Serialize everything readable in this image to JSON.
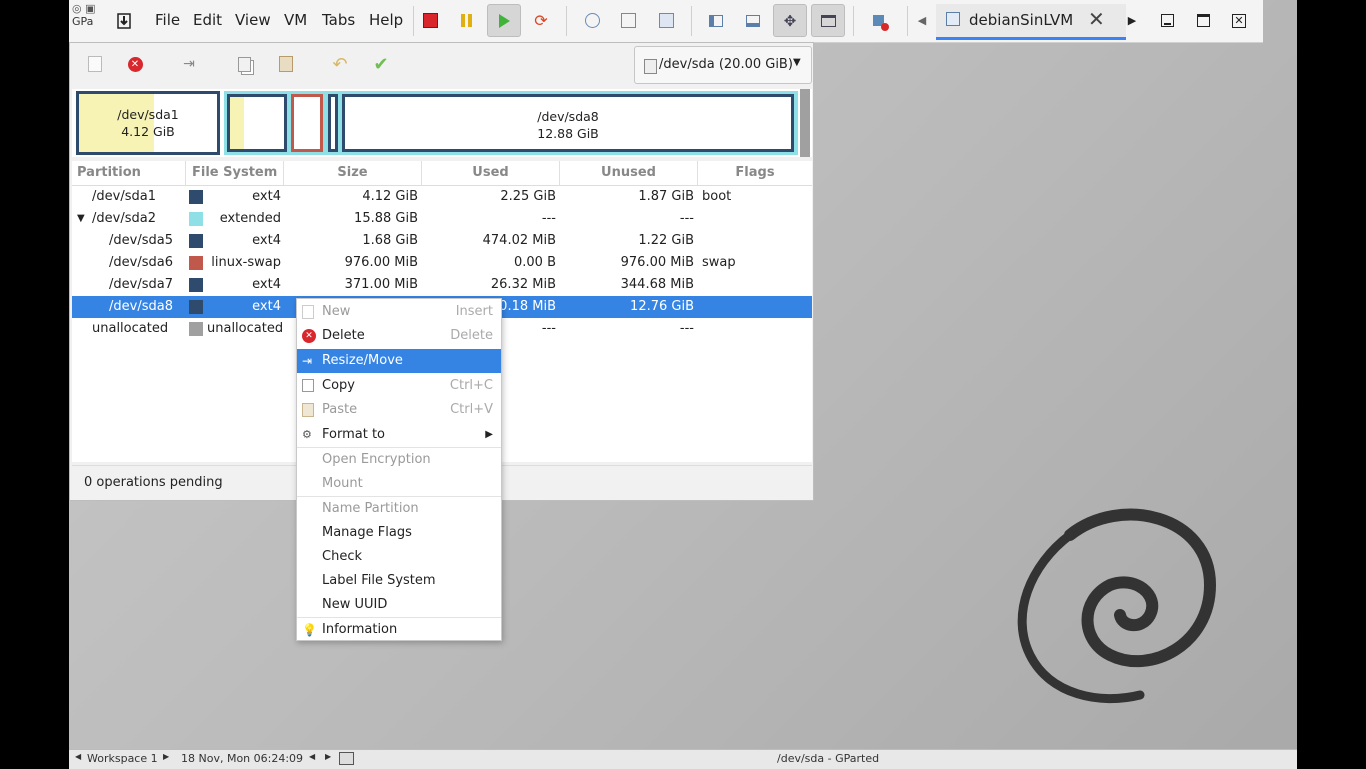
{
  "vm_menu": {
    "app_short": "GPa",
    "items": [
      "File",
      "Edit",
      "View",
      "VM",
      "Tabs",
      "Help"
    ]
  },
  "vm_tab": {
    "label": "debianSinLVM"
  },
  "device_selector": {
    "label": "/dev/sda (20.00 GiB)"
  },
  "partition_map": {
    "sda1": {
      "name": "/dev/sda1",
      "size": "4.12 GiB"
    },
    "sda8": {
      "name": "/dev/sda8",
      "size": "12.88 GiB"
    }
  },
  "table": {
    "headers": [
      "Partition",
      "File System",
      "Size",
      "Used",
      "Unused",
      "Flags"
    ],
    "rows": [
      {
        "partition": "/dev/sda1",
        "fs": "ext4",
        "size": "4.12 GiB",
        "used": "2.25 GiB",
        "unused": "1.87 GiB",
        "flags": "boot"
      },
      {
        "partition": "/dev/sda2",
        "fs": "extended",
        "size": "15.88 GiB",
        "used": "---",
        "unused": "---",
        "flags": ""
      },
      {
        "partition": "/dev/sda5",
        "fs": "ext4",
        "size": "1.68 GiB",
        "used": "474.02 MiB",
        "unused": "1.22 GiB",
        "flags": ""
      },
      {
        "partition": "/dev/sda6",
        "fs": "linux-swap",
        "size": "976.00 MiB",
        "used": "0.00 B",
        "unused": "976.00 MiB",
        "flags": "swap"
      },
      {
        "partition": "/dev/sda7",
        "fs": "ext4",
        "size": "371.00 MiB",
        "used": "26.32 MiB",
        "unused": "344.68 MiB",
        "flags": ""
      },
      {
        "partition": "/dev/sda8",
        "fs": "ext4",
        "size": "",
        "used": "0.18 MiB",
        "unused": "12.76 GiB",
        "flags": ""
      },
      {
        "partition": "unallocated",
        "fs": "unallocated",
        "size": "",
        "used": "---",
        "unused": "---",
        "flags": ""
      }
    ]
  },
  "status": {
    "text": "0 operations pending"
  },
  "context_menu": {
    "new": {
      "label": "New",
      "accel": "Insert"
    },
    "delete": {
      "label": "Delete",
      "accel": "Delete"
    },
    "resize": {
      "label": "Resize/Move"
    },
    "copy": {
      "label": "Copy",
      "accel": "Ctrl+C"
    },
    "paste": {
      "label": "Paste",
      "accel": "Ctrl+V"
    },
    "format": {
      "label": "Format to"
    },
    "open_encryption": {
      "label": "Open Encryption"
    },
    "mount": {
      "label": "Mount"
    },
    "name_partition": {
      "label": "Name Partition"
    },
    "manage_flags": {
      "label": "Manage Flags"
    },
    "check": {
      "label": "Check"
    },
    "label_fs": {
      "label": "Label File System"
    },
    "new_uuid": {
      "label": "New UUID"
    },
    "information": {
      "label": "Information"
    }
  },
  "panel": {
    "workspace": "Workspace 1",
    "clock": "18 Nov, Mon 06:24:09",
    "window_title": "/dev/sda - GParted"
  },
  "colors": {
    "ext4": "#2e4a6d",
    "extended": "#8fe0e6",
    "linux_swap": "#c0584b",
    "unallocated": "#a0a0a0",
    "selection": "#3584e4",
    "used_fill": "#f6f3b4"
  }
}
